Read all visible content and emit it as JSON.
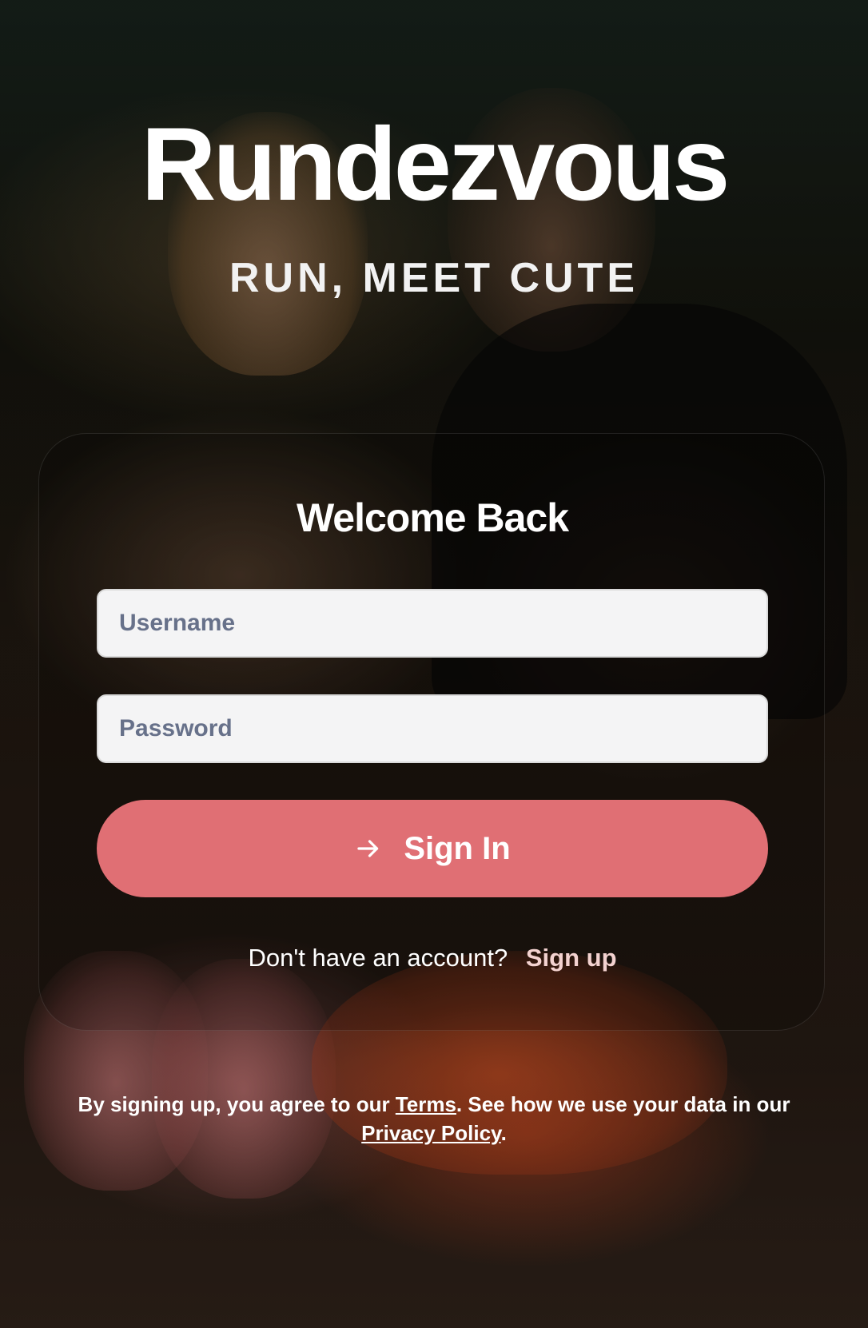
{
  "app": {
    "brand": "Rundezvous",
    "tagline": "RUN, MEET CUTE"
  },
  "login": {
    "title": "Welcome Back",
    "username_placeholder": "Username",
    "password_placeholder": "Password",
    "signin_label": "Sign In",
    "signin_icon": "arrow-right-icon",
    "signup_prompt": "Don't have an account?",
    "signup_link": "Sign up",
    "accent_color": "#e06f74"
  },
  "legal": {
    "prefix": "By signing up, you agree to our ",
    "terms": "Terms",
    "middle": ". See how we use your data in our ",
    "privacy": "Privacy Policy",
    "suffix": "."
  }
}
